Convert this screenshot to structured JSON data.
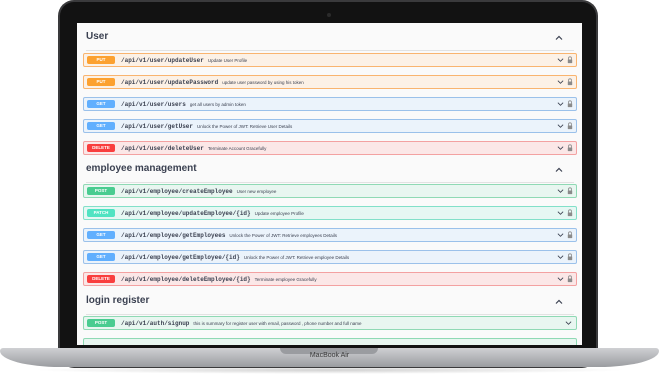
{
  "device": {
    "label": "MacBook Air"
  },
  "sections": [
    {
      "title": "User",
      "ops": [
        {
          "method": "PUT",
          "path": "/api/v1/user/updateUser",
          "summary": "Update User Profile"
        },
        {
          "method": "PUT",
          "path": "/api/v1/user/updatePassword",
          "summary": "update user password by using his token"
        },
        {
          "method": "GET",
          "path": "/api/v1/user/users",
          "summary": "get all users by admin token"
        },
        {
          "method": "GET",
          "path": "/api/v1/user/getUser",
          "summary": "Unlock the Power of JWT: Retrieve User Details"
        },
        {
          "method": "DELETE",
          "path": "/api/v1/user/deleteUser",
          "summary": "Terminate Account Gracefully"
        }
      ]
    },
    {
      "title": "employee management",
      "ops": [
        {
          "method": "POST",
          "path": "/api/v1/employee/createEmployee",
          "summary": "User new employee"
        },
        {
          "method": "PATCH",
          "path": "/api/v1/employee/updateEmployee/{id}",
          "summary": "Update employee Profile"
        },
        {
          "method": "GET",
          "path": "/api/v1/employee/getEmployees",
          "summary": "Unlock the Power of JWT: Retrieve employees Details"
        },
        {
          "method": "GET",
          "path": "/api/v1/employee/getEmployee/{id}",
          "summary": "Unlock the Power of JWT: Retrieve employee Details"
        },
        {
          "method": "DELETE",
          "path": "/api/v1/employee/deleteEmployee/{id}",
          "summary": "Terminate employee Gracefully"
        }
      ]
    },
    {
      "title": "login register",
      "ops": [
        {
          "method": "POST",
          "path": "/api/v1/auth/signup",
          "summary": "this is summary for register user with email, password , phone number and full name"
        }
      ]
    }
  ],
  "icons": {
    "collapse": "chevron-up-icon",
    "expand": "chevron-down-icon",
    "auth": "lock-icon"
  },
  "colors": {
    "put": "#fca130",
    "get": "#61affe",
    "delete": "#f93e3e",
    "post": "#49cc90",
    "patch": "#50e3c2"
  }
}
